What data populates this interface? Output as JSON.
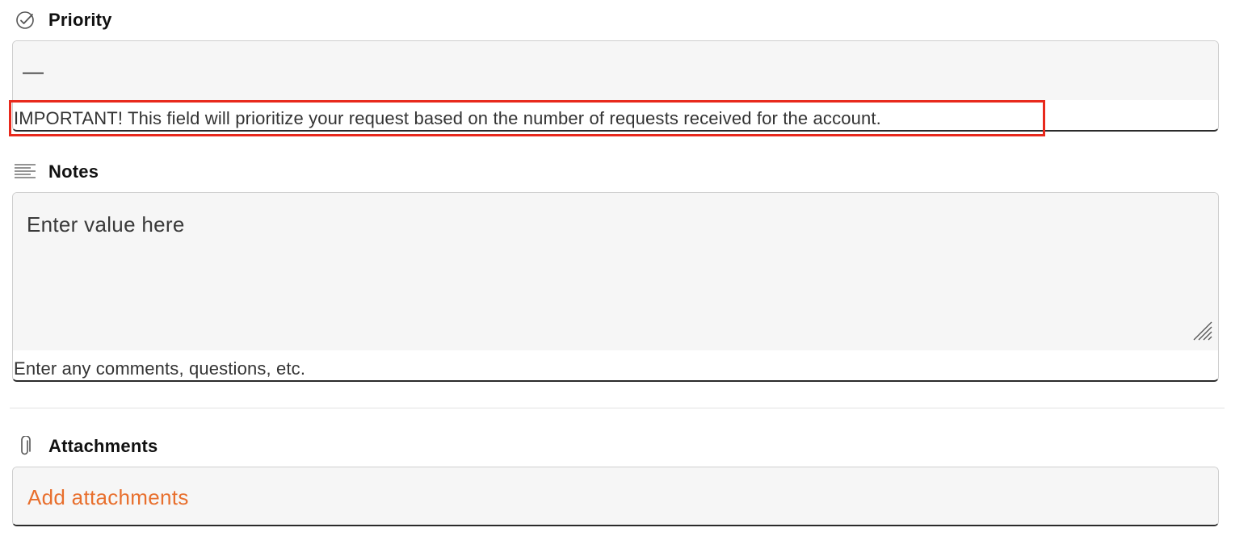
{
  "priority": {
    "label": "Priority",
    "icon": "check-circle-icon",
    "value": "—",
    "help_text": "IMPORTANT! This field will prioritize your request based on the number of requests received for the account."
  },
  "notes": {
    "label": "Notes",
    "icon": "lines-icon",
    "placeholder": "Enter value here",
    "help_text": "Enter any comments, questions, etc."
  },
  "attachments": {
    "label": "Attachments",
    "icon": "paperclip-icon",
    "action_label": "Add attachments"
  },
  "colors": {
    "highlight": "#e8291c",
    "accent": "#e86f2d",
    "field_bg": "#f6f6f6"
  }
}
